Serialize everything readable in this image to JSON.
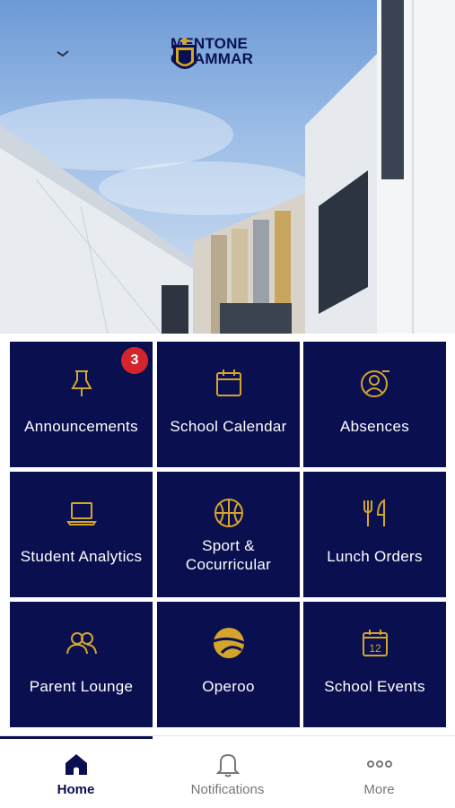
{
  "brand": {
    "line1": "MENTONE",
    "line2": "GRAMMAR"
  },
  "tiles": [
    {
      "label": "Announcements",
      "icon": "pin-icon",
      "badge": "3"
    },
    {
      "label": "School Calendar",
      "icon": "calendar-icon"
    },
    {
      "label": "Absences",
      "icon": "user-minus-icon"
    },
    {
      "label": "Student Analytics",
      "icon": "laptop-icon"
    },
    {
      "label": "Sport &",
      "label2": "Cocurricular",
      "icon": "basketball-icon"
    },
    {
      "label": "Lunch Orders",
      "icon": "fork-knife-icon"
    },
    {
      "label": "Parent Lounge",
      "icon": "users-icon"
    },
    {
      "label": "Operoo",
      "icon": "operoo-logo-icon"
    },
    {
      "label": "School Events",
      "icon": "calendar-12-icon",
      "day": "12"
    }
  ],
  "tabs": [
    {
      "label": "Home",
      "icon": "home-icon",
      "active": true
    },
    {
      "label": "Notifications",
      "icon": "bell-icon"
    },
    {
      "label": "More",
      "icon": "more-dots-icon"
    }
  ],
  "colors": {
    "navy": "#0a0f4f",
    "gold": "#d4a52b",
    "badge": "#d4252d"
  }
}
